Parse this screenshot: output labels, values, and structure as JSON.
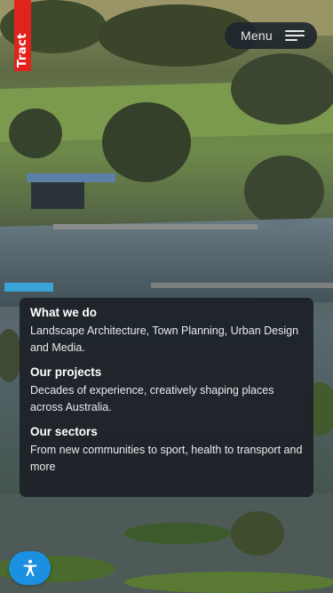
{
  "brand": {
    "logo_text": "Tract",
    "logo_color": "#e0241b"
  },
  "header": {
    "menu_label": "Menu",
    "menu_icon": "hamburger-menu-icon"
  },
  "info_card": {
    "sections": [
      {
        "heading": "What we do",
        "body": "Landscape Architecture, Town Planning, Urban Design and Media."
      },
      {
        "heading": "Our projects",
        "body": "Decades of experience, creatively shaping places across Australia."
      },
      {
        "heading": "Our sectors",
        "body": "From new communities to sport, health to transport and more"
      }
    ]
  },
  "accessibility": {
    "icon": "accessibility-icon",
    "color": "#1b8fe0"
  }
}
